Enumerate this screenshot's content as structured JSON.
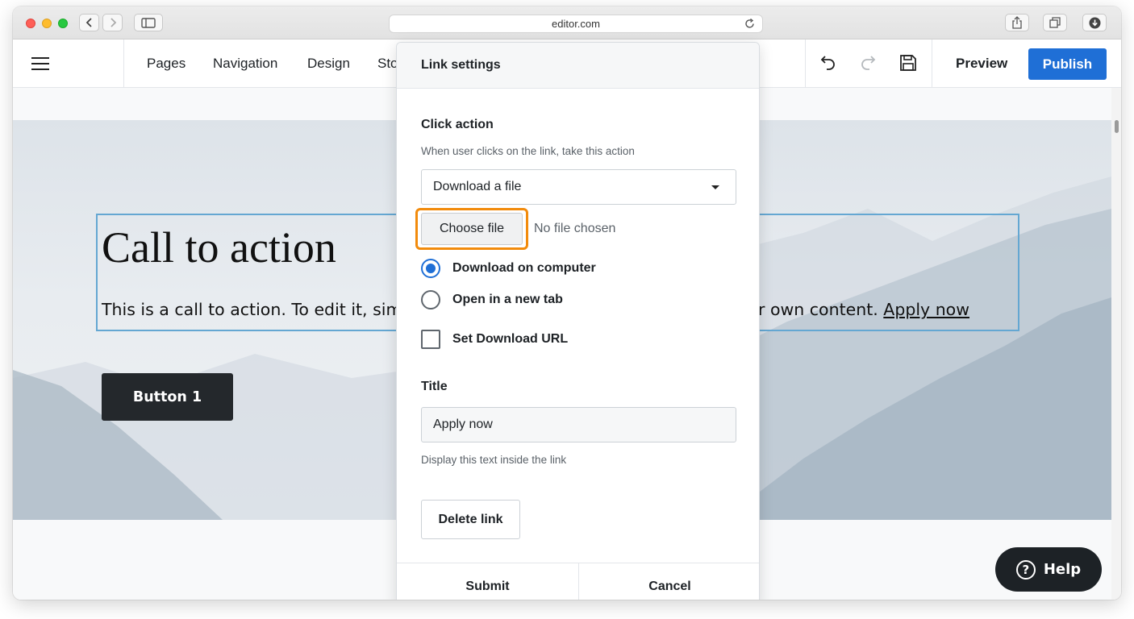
{
  "browser": {
    "url": "editor.com",
    "icons": [
      "back-icon",
      "forward-icon",
      "sidebar-icon",
      "reload-icon",
      "share-icon",
      "tabs-icon",
      "download-icon"
    ]
  },
  "header": {
    "nav": [
      "Pages",
      "Navigation",
      "Design",
      "Sto"
    ],
    "preview_label": "Preview",
    "publish_label": "Publish",
    "publish_color": "#1f6fd6"
  },
  "hero": {
    "title": "Call to action",
    "body_left": "This is a call to action. To edit it, sim",
    "body_right": "r own content. ",
    "link_text": "Apply now",
    "button_label": "Button 1"
  },
  "dialog": {
    "title": "Link settings",
    "click_action": {
      "label": "Click action",
      "hint": "When user clicks on the link, take this action",
      "selected": "Download a file"
    },
    "file": {
      "button_label": "Choose file",
      "status": "No file chosen",
      "highlight_color": "#f28b0c"
    },
    "options": [
      {
        "label": "Download on computer",
        "selected": true
      },
      {
        "label": "Open in a new tab",
        "selected": false
      }
    ],
    "set_url_label": "Set Download URL",
    "title_field": {
      "label": "Title",
      "value": "Apply now",
      "hint": "Display this text inside the link"
    },
    "delete_label": "Delete link",
    "submit_label": "Submit",
    "cancel_label": "Cancel"
  },
  "help_label": "Help"
}
